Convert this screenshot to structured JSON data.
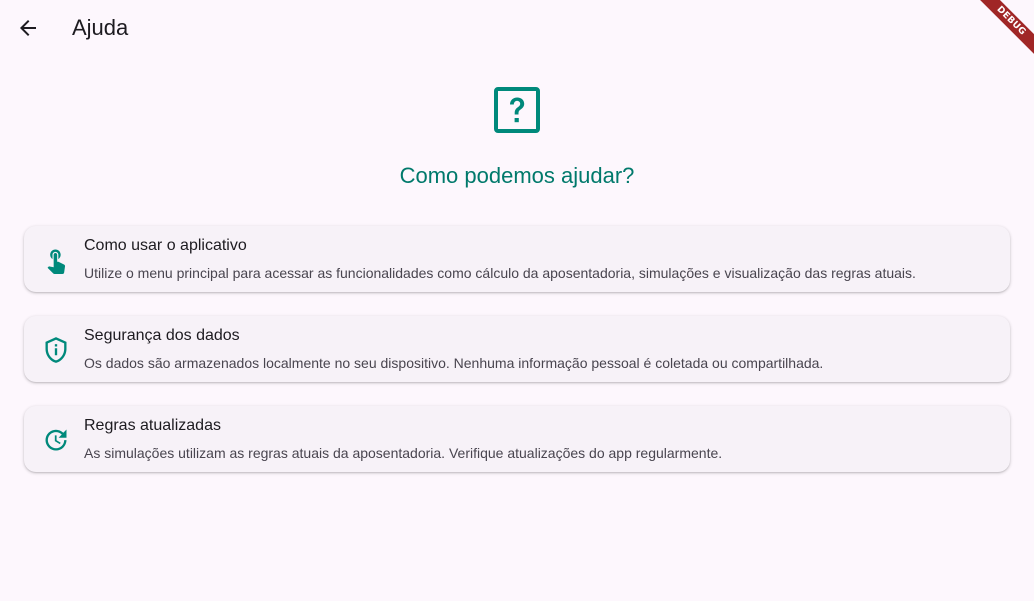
{
  "appbar": {
    "title": "Ajuda",
    "back_icon": "arrow-back-icon"
  },
  "debug_banner": "DEBUG",
  "hero": {
    "icon": "help-square-icon",
    "title": "Como podemos ajudar?"
  },
  "colors": {
    "accent": "#00897b",
    "title_accent": "#00796b",
    "background": "#fdf7fd",
    "card": "#f7f2f8",
    "debug": "#a02626"
  },
  "cards": [
    {
      "icon": "touch-app-icon",
      "title": "Como usar o aplicativo",
      "description": "Utilize o menu principal para acessar as funcionalidades como cálculo da aposentadoria, simulações e visualização das regras atuais."
    },
    {
      "icon": "shield-info-icon",
      "title": "Segurança dos dados",
      "description": "Os dados são armazenados localmente no seu dispositivo. Nenhuma informação pessoal é coletada ou compartilhada."
    },
    {
      "icon": "update-icon",
      "title": "Regras atualizadas",
      "description": "As simulações utilizam as regras atuais da aposentadoria. Verifique atualizações do app regularmente."
    }
  ]
}
